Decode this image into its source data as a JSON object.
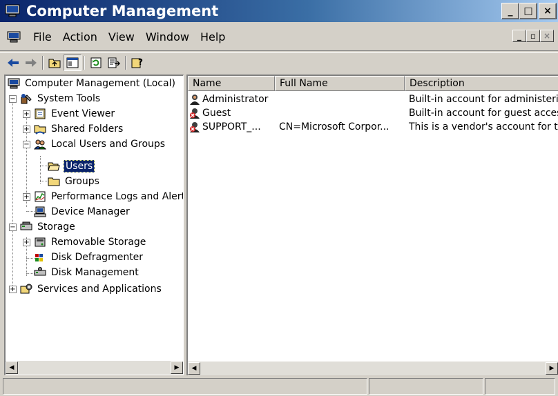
{
  "window": {
    "title": "Computer Management",
    "minimize": "_",
    "maximize": "□",
    "close": "×"
  },
  "menu": {
    "items": [
      "File",
      "Action",
      "View",
      "Window",
      "Help"
    ],
    "mdi": {
      "minimize": "_",
      "restore": "▫",
      "close": "×"
    }
  },
  "toolbar": {
    "buttons": [
      "back-icon",
      "forward-icon",
      "up-folder-icon",
      "show-tree-icon",
      "refresh-icon",
      "export-list-icon",
      "help-icon"
    ]
  },
  "tree": {
    "items": [
      {
        "label": "Computer Management (Local)",
        "icon": "computer-icon"
      },
      {
        "label": "System Tools",
        "icon": "tools-icon",
        "expander": "−"
      },
      {
        "label": "Event Viewer",
        "icon": "event-viewer-icon",
        "expander": "+"
      },
      {
        "label": "Shared Folders",
        "icon": "shared-folder-icon",
        "expander": "+"
      },
      {
        "label": "Local Users and Groups",
        "icon": "users-groups-icon",
        "expander": "−"
      },
      {
        "label": "Users",
        "icon": "folder-open-icon",
        "selected": true
      },
      {
        "label": "Groups",
        "icon": "folder-icon"
      },
      {
        "label": "Performance Logs and Alerts",
        "icon": "performance-icon",
        "expander": "+"
      },
      {
        "label": "Device Manager",
        "icon": "device-manager-icon"
      },
      {
        "label": "Storage",
        "icon": "storage-icon",
        "expander": "−"
      },
      {
        "label": "Removable Storage",
        "icon": "removable-storage-icon",
        "expander": "+"
      },
      {
        "label": "Disk Defragmenter",
        "icon": "defrag-icon"
      },
      {
        "label": "Disk Management",
        "icon": "disk-management-icon"
      },
      {
        "label": "Services and Applications",
        "icon": "services-icon",
        "expander": "+"
      }
    ]
  },
  "list": {
    "columns": [
      "Name",
      "Full Name",
      "Description"
    ],
    "rows": [
      {
        "name": "Administrator",
        "full_name": "",
        "description": "Built-in account for administering the computer/domain",
        "disabled": false
      },
      {
        "name": "Guest",
        "full_name": "",
        "description": "Built-in account for guest access to the computer/domain",
        "disabled": true
      },
      {
        "name": "SUPPORT_...",
        "full_name": "CN=Microsoft Corpor...",
        "description": "This is a vendor's account for the Help and Support Service",
        "disabled": true
      }
    ]
  },
  "colors": {
    "title_start": "#0a246a",
    "title_end": "#a6caf0",
    "face": "#d4d0c8",
    "selection": "#0a246a"
  }
}
